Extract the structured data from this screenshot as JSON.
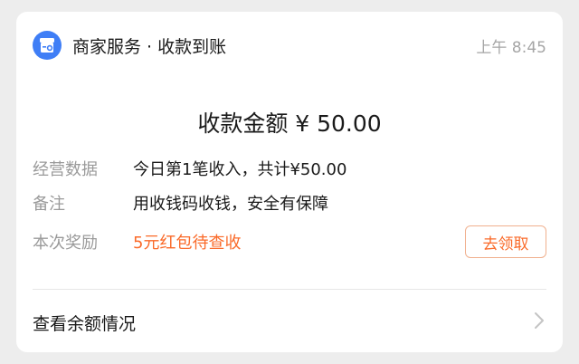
{
  "header": {
    "app_name": "商家服务 · 收款到账",
    "time": "上午 8:45",
    "icon": "shop-icon",
    "accent_color": "#3f7ef6"
  },
  "amount": {
    "text": "收款金额 ¥ 50.00"
  },
  "details": [
    {
      "label": "经营数据",
      "value": "今日第1笔收入，共计¥50.00"
    },
    {
      "label": "备注",
      "value": "用收钱码收钱，安全有保障"
    },
    {
      "label": "本次奖励",
      "value": "5元红包待查收",
      "action": "去领取",
      "value_color": "#fa6a29"
    }
  ],
  "footer": {
    "link": "查看余额情况",
    "icon": "chevron-right-icon"
  }
}
